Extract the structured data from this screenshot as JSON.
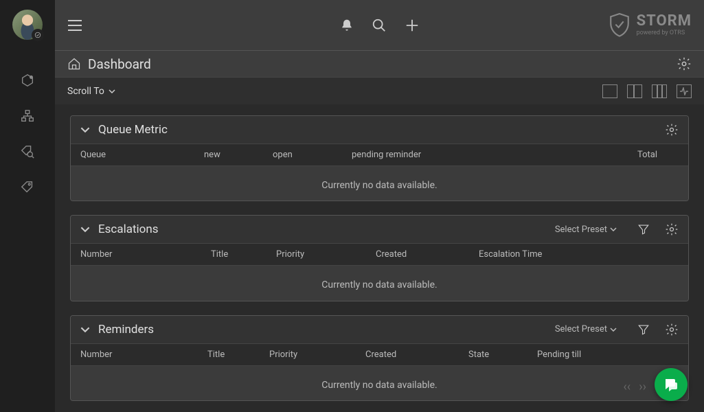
{
  "page": {
    "title": "Dashboard"
  },
  "brand": {
    "name": "STORM",
    "tagline": "powered by OTRS"
  },
  "toolbar": {
    "scroll_to": "Scroll To"
  },
  "panels": {
    "queue_metric": {
      "title": "Queue Metric",
      "columns": [
        "Queue",
        "new",
        "open",
        "pending reminder",
        "Total"
      ],
      "empty": "Currently no data available."
    },
    "escalations": {
      "title": "Escalations",
      "preset": "Select Preset",
      "columns": [
        "Number",
        "Title",
        "Priority",
        "Created",
        "Escalation Time"
      ],
      "empty": "Currently no data available."
    },
    "reminders": {
      "title": "Reminders",
      "preset": "Select Preset",
      "columns": [
        "Number",
        "Title",
        "Priority",
        "Created",
        "State",
        "Pending till"
      ],
      "empty": "Currently no data available."
    }
  }
}
